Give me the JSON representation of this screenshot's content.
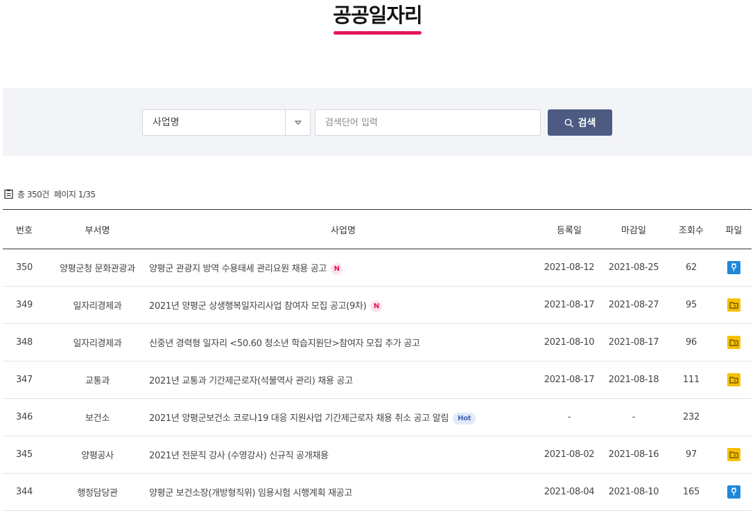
{
  "page": {
    "title": "공공일자리"
  },
  "colors": {
    "accent_pink": "#e3175c",
    "search_button": "#4d5a82",
    "badge_new_bg": "#fde3ea",
    "badge_new_text": "#e3175c",
    "badge_hot_bg": "#e2e9f8",
    "badge_hot_text": "#3f63b8",
    "file_hwp": "#1e88d8",
    "file_zip": "#f5c000"
  },
  "search": {
    "select_value": "사업명",
    "input_placeholder": "검색단어 입력",
    "button_label": "검색"
  },
  "summary": {
    "total": "총 350건",
    "page": "페이지 1/35"
  },
  "table": {
    "headers": [
      "번호",
      "부서명",
      "사업명",
      "등록일",
      "마감일",
      "조회수",
      "파일"
    ],
    "rows": [
      {
        "no": "350",
        "dept": "양평군청 문화관광과",
        "title": "양평군 관광지 방역 수용태세 관리요원 채용 공고",
        "badge": "N",
        "reg": "2021-08-12",
        "due": "2021-08-25",
        "views": "62",
        "file_icon": "hwp-file-icon"
      },
      {
        "no": "349",
        "dept": "일자리경제과",
        "title": "2021년 양평군 상생행복일자리사업 참여자 모집 공고(9차)",
        "badge": "N",
        "reg": "2021-08-17",
        "due": "2021-08-27",
        "views": "95",
        "file_icon": "zip-file-icon"
      },
      {
        "no": "348",
        "dept": "일자리경제과",
        "title": "신중년 경력형 일자리 <50.60 청소년 학습지원단>참여자 모집 추가 공고",
        "badge": "",
        "reg": "2021-08-10",
        "due": "2021-08-17",
        "views": "96",
        "file_icon": "zip-file-icon"
      },
      {
        "no": "347",
        "dept": "교통과",
        "title": "2021년 교통과 기간제근로자(석불역사 관리) 채용 공고",
        "badge": "",
        "reg": "2021-08-17",
        "due": "2021-08-18",
        "views": "111",
        "file_icon": "zip-file-icon"
      },
      {
        "no": "346",
        "dept": "보건소",
        "title": "2021년 양평군보건소 코로나19 대응 지원사업 기간제근로자 채용 취소 공고 알림",
        "badge": "Hot",
        "reg": "-",
        "due": "-",
        "views": "232",
        "file_icon": ""
      },
      {
        "no": "345",
        "dept": "양평공사",
        "title": "2021년 전문직 강사 (수영강사) 신규직 공개채용",
        "badge": "",
        "reg": "2021-08-02",
        "due": "2021-08-16",
        "views": "97",
        "file_icon": "zip-file-icon"
      },
      {
        "no": "344",
        "dept": "행정담당관",
        "title": "양평군 보건소장(개방형직위) 임용시험 시행계획 재공고",
        "badge": "",
        "reg": "2021-08-04",
        "due": "2021-08-10",
        "views": "165",
        "file_icon": "hwp-file-icon"
      }
    ]
  }
}
